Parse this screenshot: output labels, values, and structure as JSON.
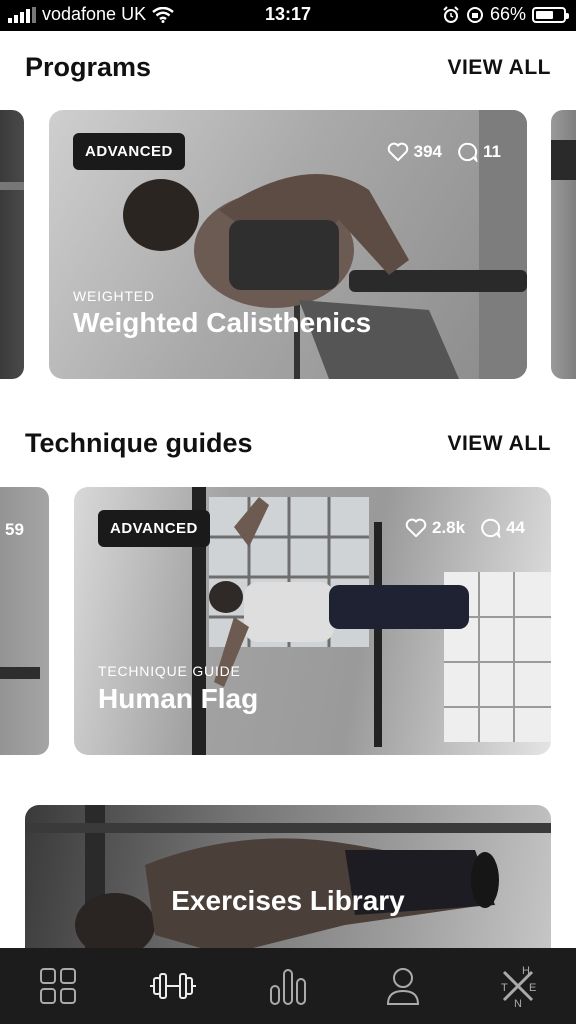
{
  "status_bar": {
    "carrier": "vodafone UK",
    "time": "13:17",
    "battery": "66%",
    "battery_level": 0.66
  },
  "sections": {
    "programs": {
      "title": "Programs",
      "view_all": "VIEW ALL",
      "card": {
        "badge": "ADVANCED",
        "likes": "394",
        "comments": "11",
        "category": "WEIGHTED",
        "title": "Weighted Calisthenics"
      }
    },
    "technique": {
      "title": "Technique guides",
      "view_all": "VIEW ALL",
      "prev_card_count": "59",
      "card": {
        "badge": "ADVANCED",
        "likes": "2.8k",
        "comments": "44",
        "category": "TECHNIQUE GUIDE",
        "title": "Human Flag"
      }
    },
    "exercises": {
      "title": "Exercises Library"
    }
  },
  "tab_bar": {
    "items": [
      {
        "icon": "grid-icon"
      },
      {
        "icon": "dumbbell-icon"
      },
      {
        "icon": "stats-icon"
      },
      {
        "icon": "profile-icon"
      },
      {
        "icon": "then-logo-icon",
        "letters": [
          "T",
          "H",
          "E",
          "N"
        ]
      }
    ]
  },
  "colors": {
    "tab_bar_bg": "#1c1c1c",
    "badge_bg": "#1a1a1a",
    "text_dark": "#111111"
  }
}
